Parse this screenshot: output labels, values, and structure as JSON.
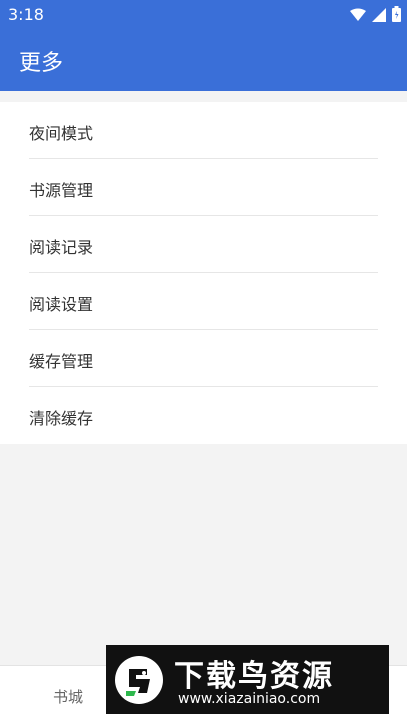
{
  "status_bar": {
    "time": "3:18",
    "icons": [
      "wifi-icon",
      "signal-icon",
      "battery-icon"
    ]
  },
  "app_bar": {
    "title": "更多"
  },
  "menu": {
    "items": [
      {
        "label": "夜间模式"
      },
      {
        "label": "书源管理"
      },
      {
        "label": "阅读记录"
      },
      {
        "label": "阅读设置"
      },
      {
        "label": "缓存管理"
      },
      {
        "label": "清除缓存"
      }
    ]
  },
  "bottom_nav": {
    "items": [
      {
        "label": "书城"
      }
    ]
  },
  "ad_banner": {
    "title": "下载鸟资源",
    "url": "www.xiazainiao.com"
  },
  "colors": {
    "primary": "#3a6fd8",
    "background": "#f3f3f3",
    "surface": "#ffffff",
    "text": "#333333"
  }
}
